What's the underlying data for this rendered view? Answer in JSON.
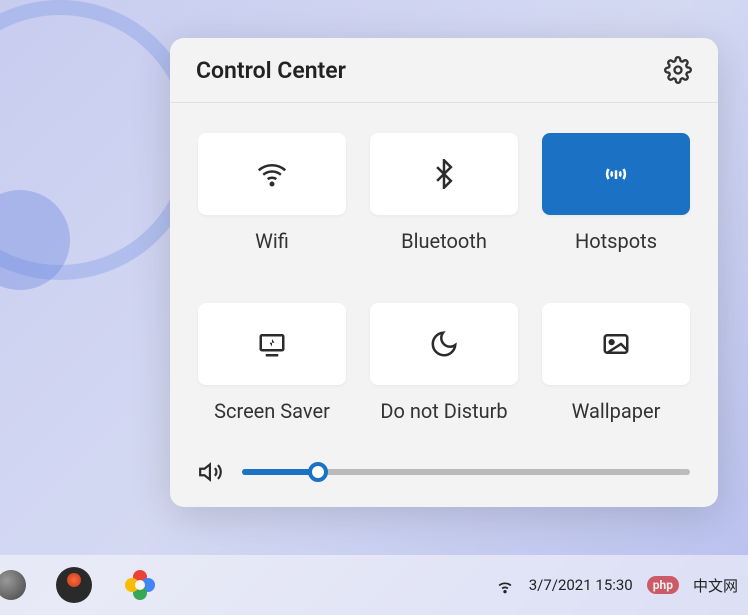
{
  "panel": {
    "title": "Control Center",
    "tiles": {
      "wifi": "Wifi",
      "bluetooth": "Bluetooth",
      "hotspots": "Hotspots",
      "screensaver": "Screen Saver",
      "dnd": "Do not Disturb",
      "wallpaper": "Wallpaper"
    }
  },
  "volume": {
    "percent": 17
  },
  "taskbar": {
    "datetime": "3/7/2021 15:30",
    "lang": "中文网",
    "php": "php"
  }
}
